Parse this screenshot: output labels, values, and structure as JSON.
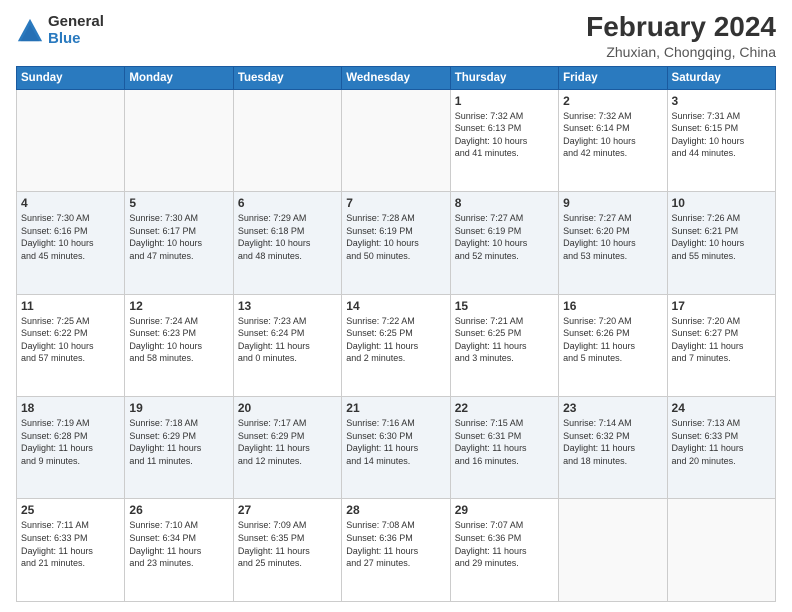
{
  "logo": {
    "general": "General",
    "blue": "Blue"
  },
  "title": "February 2024",
  "subtitle": "Zhuxian, Chongqing, China",
  "weekdays": [
    "Sunday",
    "Monday",
    "Tuesday",
    "Wednesday",
    "Thursday",
    "Friday",
    "Saturday"
  ],
  "weeks": [
    [
      {
        "day": "",
        "info": ""
      },
      {
        "day": "",
        "info": ""
      },
      {
        "day": "",
        "info": ""
      },
      {
        "day": "",
        "info": ""
      },
      {
        "day": "1",
        "info": "Sunrise: 7:32 AM\nSunset: 6:13 PM\nDaylight: 10 hours\nand 41 minutes."
      },
      {
        "day": "2",
        "info": "Sunrise: 7:32 AM\nSunset: 6:14 PM\nDaylight: 10 hours\nand 42 minutes."
      },
      {
        "day": "3",
        "info": "Sunrise: 7:31 AM\nSunset: 6:15 PM\nDaylight: 10 hours\nand 44 minutes."
      }
    ],
    [
      {
        "day": "4",
        "info": "Sunrise: 7:30 AM\nSunset: 6:16 PM\nDaylight: 10 hours\nand 45 minutes."
      },
      {
        "day": "5",
        "info": "Sunrise: 7:30 AM\nSunset: 6:17 PM\nDaylight: 10 hours\nand 47 minutes."
      },
      {
        "day": "6",
        "info": "Sunrise: 7:29 AM\nSunset: 6:18 PM\nDaylight: 10 hours\nand 48 minutes."
      },
      {
        "day": "7",
        "info": "Sunrise: 7:28 AM\nSunset: 6:19 PM\nDaylight: 10 hours\nand 50 minutes."
      },
      {
        "day": "8",
        "info": "Sunrise: 7:27 AM\nSunset: 6:19 PM\nDaylight: 10 hours\nand 52 minutes."
      },
      {
        "day": "9",
        "info": "Sunrise: 7:27 AM\nSunset: 6:20 PM\nDaylight: 10 hours\nand 53 minutes."
      },
      {
        "day": "10",
        "info": "Sunrise: 7:26 AM\nSunset: 6:21 PM\nDaylight: 10 hours\nand 55 minutes."
      }
    ],
    [
      {
        "day": "11",
        "info": "Sunrise: 7:25 AM\nSunset: 6:22 PM\nDaylight: 10 hours\nand 57 minutes."
      },
      {
        "day": "12",
        "info": "Sunrise: 7:24 AM\nSunset: 6:23 PM\nDaylight: 10 hours\nand 58 minutes."
      },
      {
        "day": "13",
        "info": "Sunrise: 7:23 AM\nSunset: 6:24 PM\nDaylight: 11 hours\nand 0 minutes."
      },
      {
        "day": "14",
        "info": "Sunrise: 7:22 AM\nSunset: 6:25 PM\nDaylight: 11 hours\nand 2 minutes."
      },
      {
        "day": "15",
        "info": "Sunrise: 7:21 AM\nSunset: 6:25 PM\nDaylight: 11 hours\nand 3 minutes."
      },
      {
        "day": "16",
        "info": "Sunrise: 7:20 AM\nSunset: 6:26 PM\nDaylight: 11 hours\nand 5 minutes."
      },
      {
        "day": "17",
        "info": "Sunrise: 7:20 AM\nSunset: 6:27 PM\nDaylight: 11 hours\nand 7 minutes."
      }
    ],
    [
      {
        "day": "18",
        "info": "Sunrise: 7:19 AM\nSunset: 6:28 PM\nDaylight: 11 hours\nand 9 minutes."
      },
      {
        "day": "19",
        "info": "Sunrise: 7:18 AM\nSunset: 6:29 PM\nDaylight: 11 hours\nand 11 minutes."
      },
      {
        "day": "20",
        "info": "Sunrise: 7:17 AM\nSunset: 6:29 PM\nDaylight: 11 hours\nand 12 minutes."
      },
      {
        "day": "21",
        "info": "Sunrise: 7:16 AM\nSunset: 6:30 PM\nDaylight: 11 hours\nand 14 minutes."
      },
      {
        "day": "22",
        "info": "Sunrise: 7:15 AM\nSunset: 6:31 PM\nDaylight: 11 hours\nand 16 minutes."
      },
      {
        "day": "23",
        "info": "Sunrise: 7:14 AM\nSunset: 6:32 PM\nDaylight: 11 hours\nand 18 minutes."
      },
      {
        "day": "24",
        "info": "Sunrise: 7:13 AM\nSunset: 6:33 PM\nDaylight: 11 hours\nand 20 minutes."
      }
    ],
    [
      {
        "day": "25",
        "info": "Sunrise: 7:11 AM\nSunset: 6:33 PM\nDaylight: 11 hours\nand 21 minutes."
      },
      {
        "day": "26",
        "info": "Sunrise: 7:10 AM\nSunset: 6:34 PM\nDaylight: 11 hours\nand 23 minutes."
      },
      {
        "day": "27",
        "info": "Sunrise: 7:09 AM\nSunset: 6:35 PM\nDaylight: 11 hours\nand 25 minutes."
      },
      {
        "day": "28",
        "info": "Sunrise: 7:08 AM\nSunset: 6:36 PM\nDaylight: 11 hours\nand 27 minutes."
      },
      {
        "day": "29",
        "info": "Sunrise: 7:07 AM\nSunset: 6:36 PM\nDaylight: 11 hours\nand 29 minutes."
      },
      {
        "day": "",
        "info": ""
      },
      {
        "day": "",
        "info": ""
      }
    ]
  ]
}
